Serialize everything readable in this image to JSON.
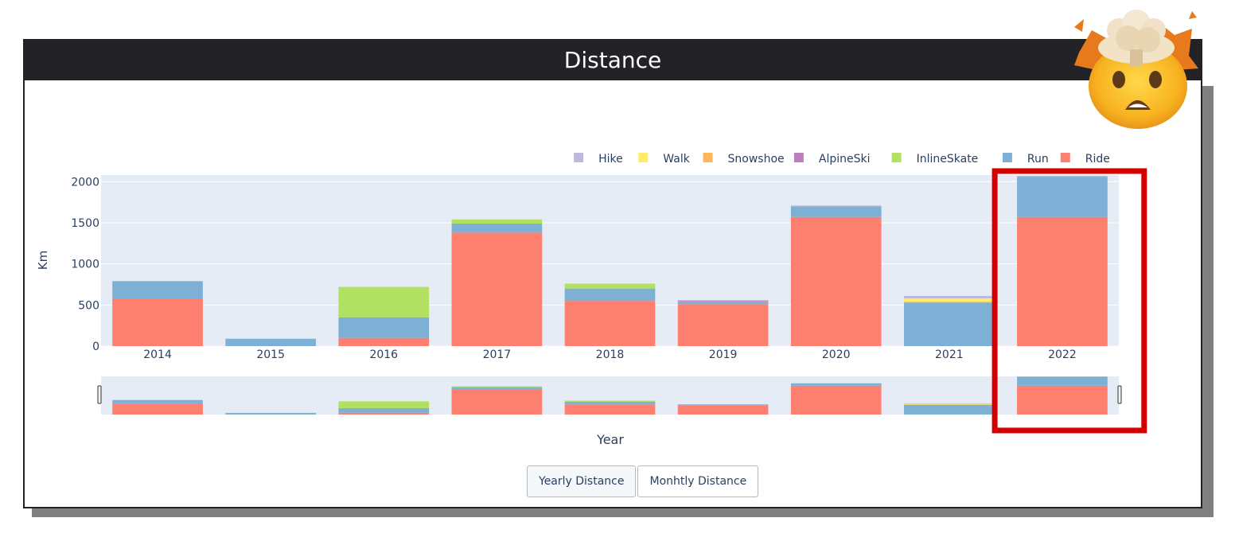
{
  "panel": {
    "title": "Distance"
  },
  "buttons": [
    {
      "label": "Yearly Distance",
      "active": true
    },
    {
      "label": "Monhtly Distance",
      "active": false
    }
  ],
  "colors": {
    "Ride": "#fd7f6f",
    "Run": "#7eb0d5",
    "InlineSkate": "#b2e061",
    "AlpineSki": "#bd7ebe",
    "Snowshoe": "#ffb55a",
    "Walk": "#ffee65",
    "Hike": "#beb9db",
    "highlight": "#d40000"
  },
  "chart_data": {
    "type": "bar",
    "stacked": true,
    "title": "",
    "xlabel": "Year",
    "ylabel": "Km",
    "ylim": [
      0,
      2080
    ],
    "yticks": [
      0,
      500,
      1000,
      1500,
      2000
    ],
    "grid": true,
    "legend_position": "top-right",
    "legend": [
      "Hike",
      "Walk",
      "Snowshoe",
      "AlpineSki",
      "InlineSkate",
      "Run",
      "Ride"
    ],
    "categories": [
      "2014",
      "2015",
      "2016",
      "2017",
      "2018",
      "2019",
      "2020",
      "2021",
      "2022"
    ],
    "series": [
      {
        "name": "Ride",
        "values": [
          580,
          0,
          100,
          1380,
          550,
          510,
          1570,
          0,
          1570
        ]
      },
      {
        "name": "Run",
        "values": [
          210,
          90,
          250,
          110,
          150,
          30,
          130,
          530,
          490
        ]
      },
      {
        "name": "InlineSkate",
        "values": [
          0,
          0,
          370,
          50,
          60,
          0,
          0,
          0,
          0
        ]
      },
      {
        "name": "AlpineSki",
        "values": [
          0,
          0,
          0,
          0,
          0,
          10,
          0,
          0,
          0
        ]
      },
      {
        "name": "Snowshoe",
        "values": [
          0,
          0,
          0,
          0,
          0,
          0,
          0,
          10,
          0
        ]
      },
      {
        "name": "Walk",
        "values": [
          0,
          0,
          0,
          0,
          0,
          0,
          0,
          40,
          0
        ]
      },
      {
        "name": "Hike",
        "values": [
          0,
          0,
          0,
          0,
          0,
          10,
          10,
          30,
          10
        ]
      }
    ],
    "highlighted_category": "2022",
    "rangeslider": true
  }
}
